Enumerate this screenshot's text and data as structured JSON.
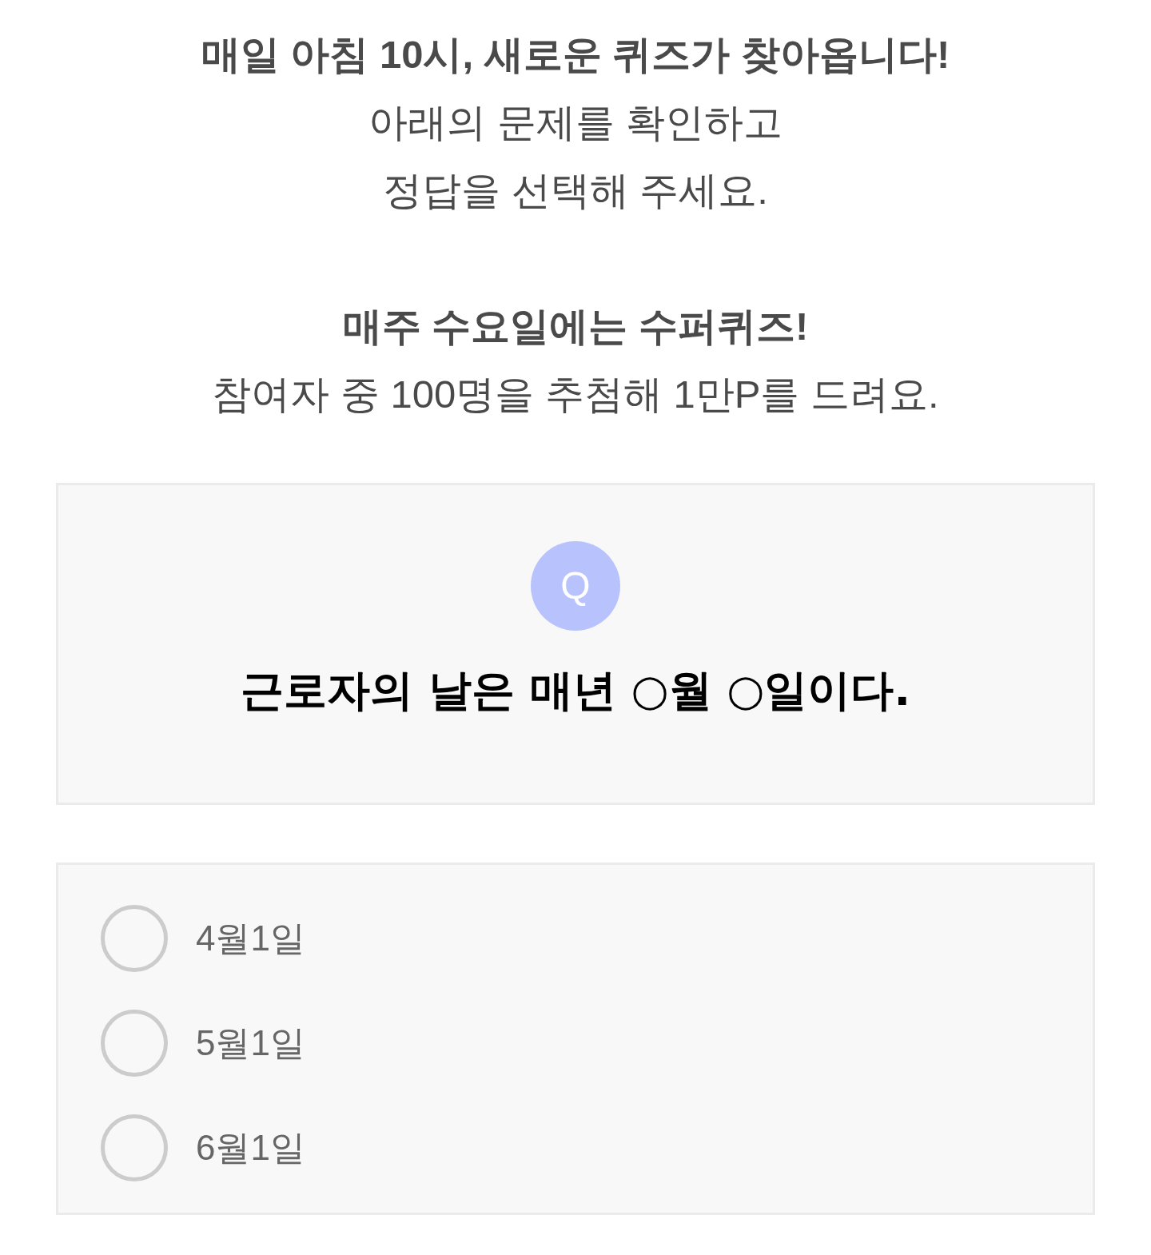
{
  "notices": [
    {
      "title": "매일 아침 10시, 새로운 퀴즈가 찾아옵니다!",
      "lines": [
        "아래의 문제를 확인하고",
        "정답을 선택해 주세요."
      ]
    },
    {
      "title": "매주 수요일에는 수퍼퀴즈!",
      "lines": [
        "참여자 중 100명을 추첨해 1만P를 드려요."
      ]
    }
  ],
  "question": {
    "badge": "Q",
    "text": "근로자의 날은 매년 ○월 ○일이다."
  },
  "options": [
    {
      "label": "4월1일",
      "selected": false
    },
    {
      "label": "5월1일",
      "selected": false
    },
    {
      "label": "6월1일",
      "selected": false
    }
  ]
}
